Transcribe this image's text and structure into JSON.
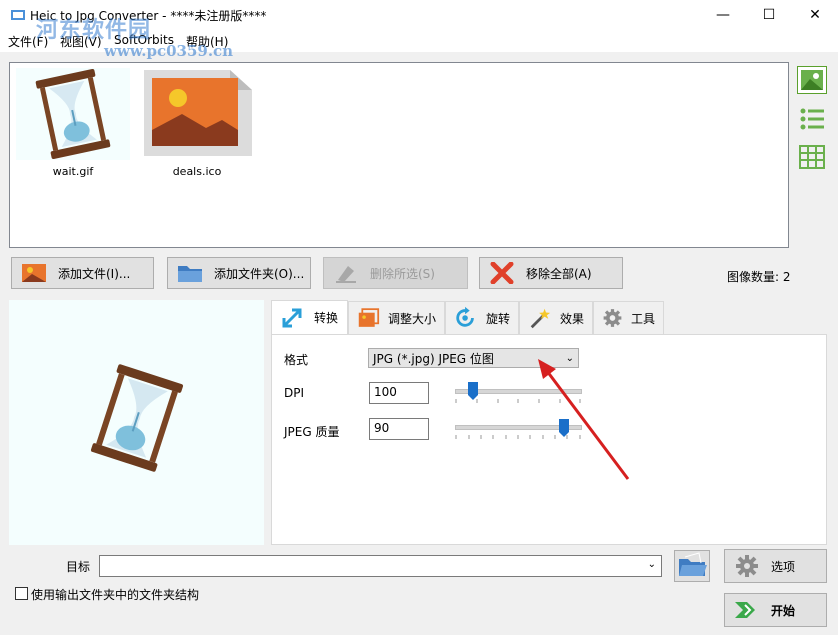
{
  "window": {
    "title": "Heic to Jpg Converter  - ****未注册版****",
    "watermark": "河东软件园",
    "watermark_url": "www.pc0359.cn"
  },
  "menu": [
    "文件(F)",
    "视图(V)",
    "SoftOrbits",
    "帮助(H)"
  ],
  "files": [
    {
      "name": "wait.gif",
      "icon": "hourglass-icon"
    },
    {
      "name": "deals.ico",
      "icon": "image-file-icon"
    }
  ],
  "view_buttons": [
    "thumbnail-view-icon",
    "list-view-icon",
    "table-view-icon"
  ],
  "actions": {
    "add_file": "添加文件(I)...",
    "add_folder": "添加文件夹(O)...",
    "delete_selected": "删除所选(S)",
    "remove_all": "移除全部(A)"
  },
  "image_count_label": "图像数量: 2",
  "tabs": [
    "转换",
    "调整大小",
    "旋转",
    "效果",
    "工具"
  ],
  "convert": {
    "format_label": "格式",
    "format_value": "JPG (*.jpg) JPEG 位图",
    "dpi_label": "DPI",
    "dpi_value": "100",
    "dpi_slider_position": 0.15,
    "quality_label": "JPEG 质量",
    "quality_value": "90",
    "quality_slider_position": 0.9
  },
  "bottom": {
    "target_label": "目标",
    "target_value": "",
    "options_label": "选项",
    "start_label": "开始",
    "folder_structure_label": "使用输出文件夹中的文件夹结构",
    "folder_structure_checked": false
  },
  "colors": {
    "arrow": "#d62020",
    "slider_thumb": "#1a6fc9",
    "preview_bg": "#f4fefe"
  }
}
